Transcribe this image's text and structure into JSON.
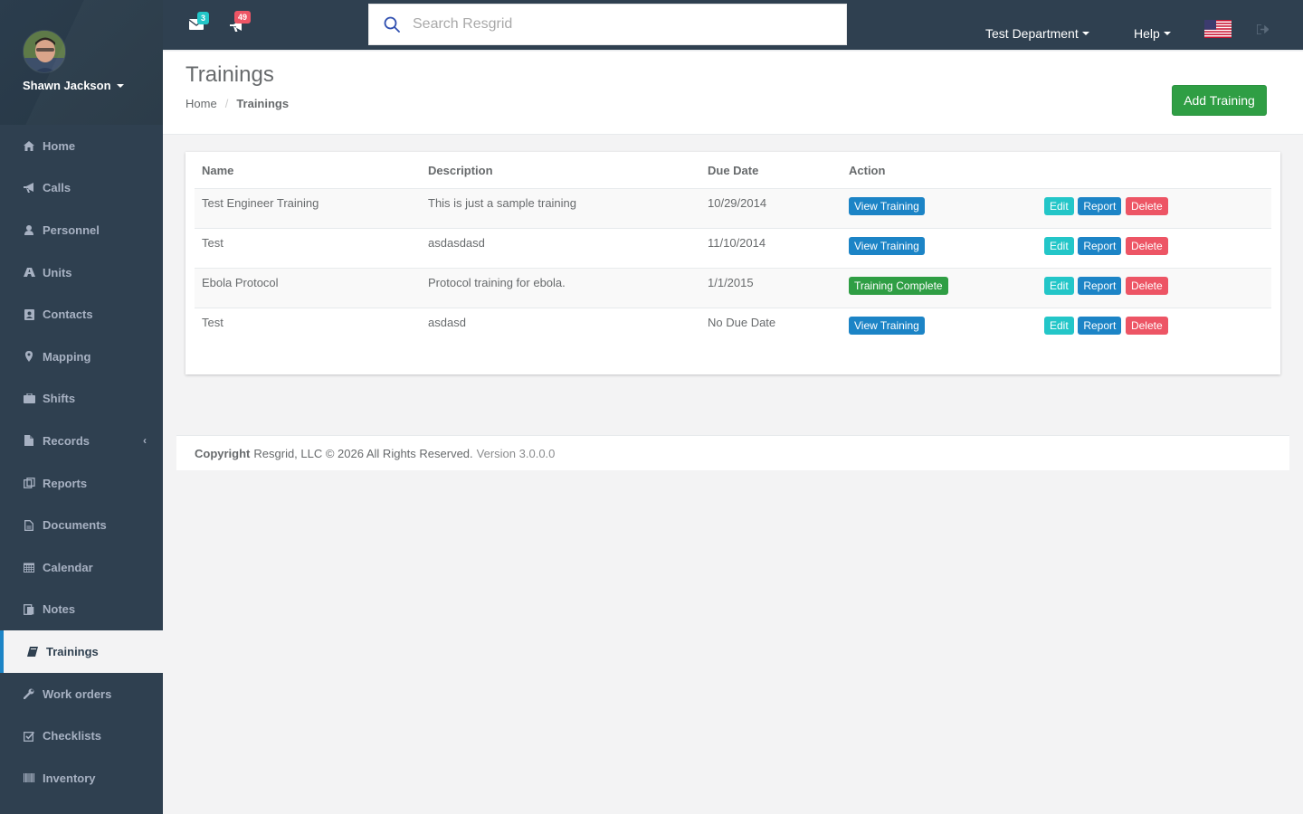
{
  "user": {
    "name": "Shawn Jackson"
  },
  "sidebar": {
    "items": [
      {
        "label": "Home",
        "icon": "home-icon"
      },
      {
        "label": "Calls",
        "icon": "bullhorn-icon"
      },
      {
        "label": "Personnel",
        "icon": "user-icon"
      },
      {
        "label": "Units",
        "icon": "truck-icon"
      },
      {
        "label": "Contacts",
        "icon": "address-book-icon"
      },
      {
        "label": "Mapping",
        "icon": "map-marker-icon"
      },
      {
        "label": "Shifts",
        "icon": "briefcase-icon"
      },
      {
        "label": "Records",
        "icon": "file-icon"
      },
      {
        "label": "Reports",
        "icon": "report-icon"
      },
      {
        "label": "Documents",
        "icon": "document-icon"
      },
      {
        "label": "Calendar",
        "icon": "calendar-icon"
      },
      {
        "label": "Notes",
        "icon": "notes-icon"
      },
      {
        "label": "Trainings",
        "icon": "book-icon"
      },
      {
        "label": "Work orders",
        "icon": "wrench-icon"
      },
      {
        "label": "Checklists",
        "icon": "checklist-icon"
      },
      {
        "label": "Inventory",
        "icon": "barcode-icon"
      }
    ],
    "active": "Trainings"
  },
  "topbar": {
    "messages_count": "3",
    "notifications_count": "49",
    "search_placeholder": "Search Resgrid",
    "department": "Test Department",
    "help": "Help",
    "colors": {
      "teal_badge": "#23c6c8",
      "red_badge": "#ed5565"
    }
  },
  "heading": {
    "title": "Trainings",
    "breadcrumb": {
      "home": "Home",
      "current": "Trainings"
    },
    "add_button": "Add Training"
  },
  "table": {
    "headers": {
      "name": "Name",
      "description": "Description",
      "due_date": "Due Date",
      "action": "Action"
    },
    "rows": [
      {
        "name": "Test Engineer Training",
        "description": "This is just a sample training",
        "due_date": "10/29/2014",
        "primary_action": "View Training",
        "primary_color": "#1c84c6"
      },
      {
        "name": "Test",
        "description": "asdasdasd",
        "due_date": "11/10/2014",
        "primary_action": "View Training",
        "primary_color": "#1c84c6"
      },
      {
        "name": "Ebola Protocol",
        "description": "Protocol training for ebola.",
        "due_date": "1/1/2015",
        "primary_action": "Training Complete",
        "primary_color": "#2f9e44"
      },
      {
        "name": "Test",
        "description": "asdasd",
        "due_date": "No Due Date",
        "primary_action": "View Training",
        "primary_color": "#1c84c6"
      }
    ],
    "row_buttons": {
      "edit": "Edit",
      "report": "Report",
      "delete": "Delete"
    }
  },
  "footer": {
    "copyright_label": "Copyright",
    "copyright_text": "Resgrid, LLC © 2026 All Rights Reserved.",
    "version": "Version 3.0.0.0"
  }
}
